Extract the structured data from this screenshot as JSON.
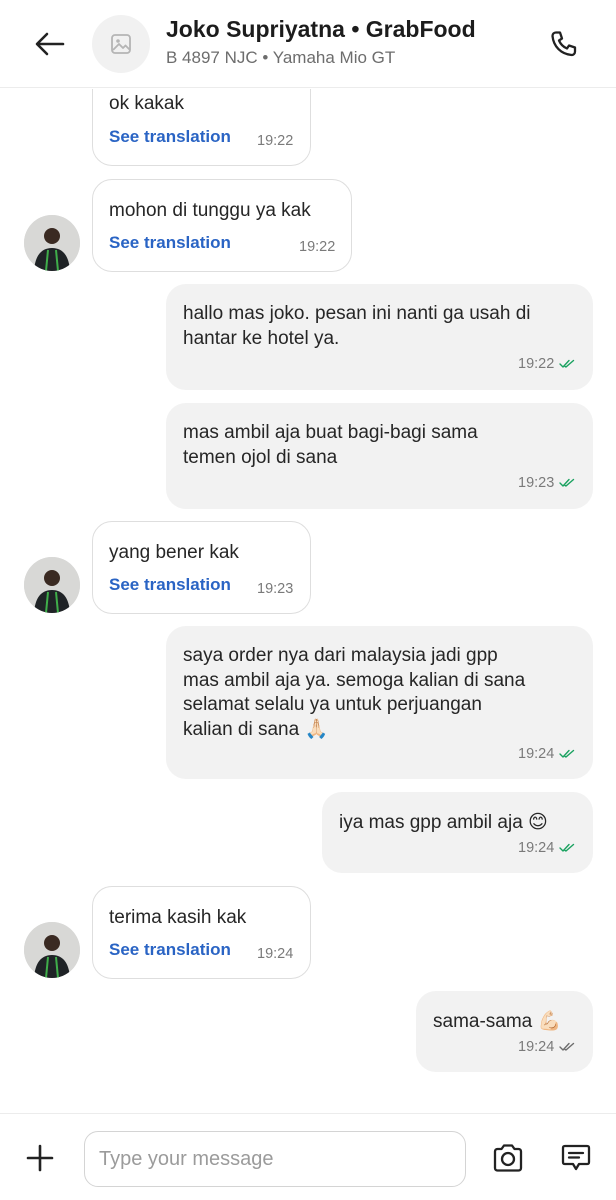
{
  "header": {
    "title": "Joko Supriyatna • GrabFood",
    "subtitle": "B 4897 NJC • Yamaha Mio GT",
    "back_icon": "arrow-left-icon",
    "avatar_icon": "image-placeholder-icon",
    "call_icon": "phone-icon"
  },
  "messages": [
    {
      "direction": "incoming",
      "text": "ok kakak",
      "translate_label": "See translation",
      "time": "19:22"
    },
    {
      "direction": "incoming",
      "text": "mohon di tunggu ya kak",
      "translate_label": "See translation",
      "time": "19:22"
    },
    {
      "direction": "outgoing",
      "lines": [
        "hallo mas joko. pesan ini nanti ga usah di",
        "hantar ke hotel ya."
      ],
      "time": "19:22",
      "status": "read"
    },
    {
      "direction": "outgoing",
      "lines": [
        "mas ambil aja buat bagi-bagi sama",
        "temen ojol di sana"
      ],
      "time": "19:23",
      "status": "read"
    },
    {
      "direction": "incoming",
      "text": "yang bener kak",
      "translate_label": "See translation",
      "time": "19:23"
    },
    {
      "direction": "outgoing",
      "lines": [
        "saya order nya dari malaysia jadi gpp",
        "mas ambil aja ya. semoga kalian di sana",
        "selamat selalu ya untuk perjuangan",
        "kalian di sana 🙏🏻"
      ],
      "time": "19:24",
      "status": "read"
    },
    {
      "direction": "outgoing",
      "text": "iya mas gpp ambil aja 😊",
      "time": "19:24",
      "status": "read"
    },
    {
      "direction": "incoming",
      "text": "terima kasih kak",
      "translate_label": "See translation",
      "time": "19:24"
    },
    {
      "direction": "outgoing",
      "text": "sama-sama 💪🏻",
      "time": "19:24",
      "status": "delivered"
    }
  ],
  "composer": {
    "placeholder": "Type your message",
    "plus_icon": "plus-icon",
    "camera_icon": "camera-icon",
    "quick_reply_icon": "chat-bubble-icon"
  },
  "colors": {
    "link_blue": "#2a64c4",
    "read_tick_green": "#1aa260",
    "delivered_tick_gray": "#6d6d6d",
    "outgoing_bubble": "#f2f2f2"
  }
}
